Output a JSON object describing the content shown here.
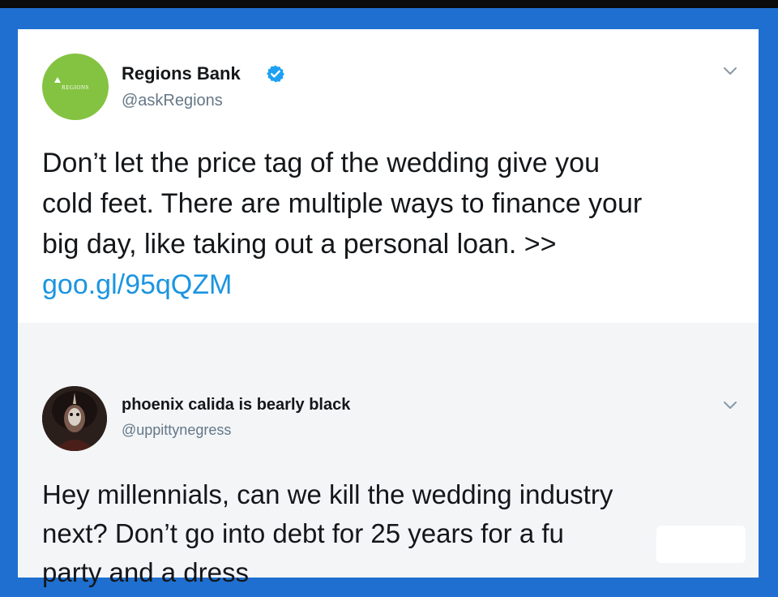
{
  "tweet1": {
    "avatar_label": "REGIONS",
    "name": "Regions Bank",
    "handle": "@askRegions",
    "verified": true,
    "text_lines": [
      "Don’t let the price tag of the wedding give you",
      "cold feet. There are multiple ways to finance your",
      "big day, like taking out a personal loan. >>"
    ],
    "link": "goo.gl/95qQZM"
  },
  "tweet2": {
    "name": "phoenix calida is bearly black",
    "handle": "@uppittynegress",
    "text_lines": [
      "Hey millennials, can we kill the wedding industry",
      "next? Don’t go into debt for 25 years for a fu",
      "party and a dress"
    ]
  },
  "icons": {
    "verified": "verified-badge-icon",
    "more": "chevron-down-icon"
  },
  "colors": {
    "background": "#1f6fd0",
    "link": "#1b95e0",
    "verified": "#1da1f2",
    "regions_green": "#84c341"
  }
}
